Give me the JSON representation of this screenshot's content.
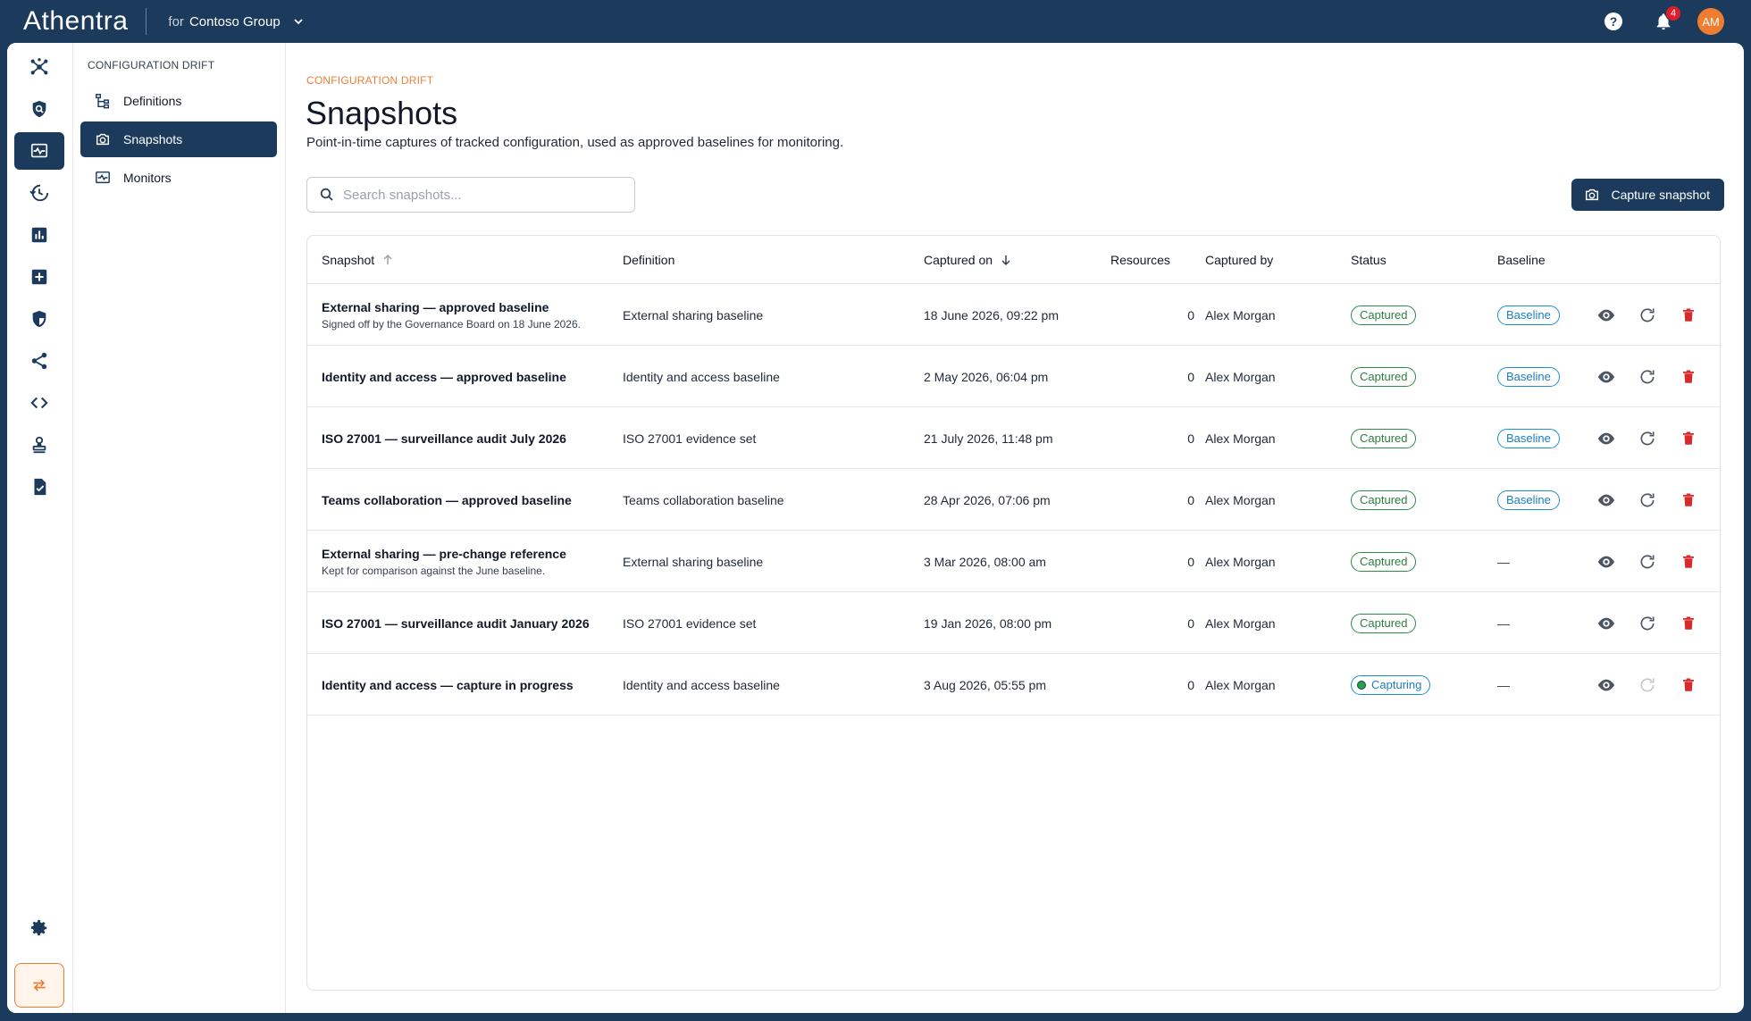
{
  "app": {
    "brand": "Athentra",
    "tenant_prefix": "for",
    "tenant_name": "Contoso Group",
    "notifications_count": "4",
    "avatar_initials": "AM",
    "accent": "#ef7d2f",
    "navy": "#1b3a5c"
  },
  "rail": {
    "items": [
      "network-icon",
      "shield-search-icon",
      "drift-monitor-icon",
      "history-icon",
      "bar-chart-icon",
      "add-box-icon",
      "security-shield-icon",
      "share-icon",
      "code-icon",
      "stamp-icon",
      "checklist-icon"
    ],
    "active": "drift-monitor-icon",
    "bottom": [
      "settings-icon",
      "swap-icon"
    ]
  },
  "subnav": {
    "heading": "CONFIGURATION DRIFT",
    "items": [
      {
        "label": "Definitions",
        "icon": "tree-icon"
      },
      {
        "label": "Snapshots",
        "icon": "camera-icon",
        "active": true
      },
      {
        "label": "Monitors",
        "icon": "monitor-icon"
      }
    ]
  },
  "page": {
    "breadcrumb": "CONFIGURATION DRIFT",
    "title": "Snapshots",
    "subtitle": "Point-in-time captures of tracked configuration, used as approved baselines for monitoring.",
    "search_placeholder": "Search snapshots...",
    "capture_button": "Capture snapshot"
  },
  "table": {
    "columns": {
      "snapshot": "Snapshot",
      "definition": "Definition",
      "captured_on": "Captured on",
      "resources": "Resources",
      "captured_by": "Captured by",
      "status": "Status",
      "baseline": "Baseline"
    },
    "rows": [
      {
        "name": "External sharing — approved baseline",
        "note": "Signed off by the Governance Board on 18 June 2026.",
        "definition": "External sharing baseline",
        "captured_on": "18 June 2026, 09:22 pm",
        "resources": "0",
        "captured_by": "Alex Morgan",
        "status": "Captured",
        "baseline": "Baseline"
      },
      {
        "name": "Identity and access — approved baseline",
        "note": "",
        "definition": "Identity and access baseline",
        "captured_on": "2 May 2026, 06:04 pm",
        "resources": "0",
        "captured_by": "Alex Morgan",
        "status": "Captured",
        "baseline": "Baseline"
      },
      {
        "name": "ISO 27001 — surveillance audit July 2026",
        "note": "",
        "definition": "ISO 27001 evidence set",
        "captured_on": "21 July 2026, 11:48 pm",
        "resources": "0",
        "captured_by": "Alex Morgan",
        "status": "Captured",
        "baseline": "Baseline"
      },
      {
        "name": "Teams collaboration — approved baseline",
        "note": "",
        "definition": "Teams collaboration baseline",
        "captured_on": "28 Apr 2026, 07:06 pm",
        "resources": "0",
        "captured_by": "Alex Morgan",
        "status": "Captured",
        "baseline": "Baseline"
      },
      {
        "name": "External sharing — pre-change reference",
        "note": "Kept for comparison against the June baseline.",
        "definition": "External sharing baseline",
        "captured_on": "3 Mar 2026, 08:00 am",
        "resources": "0",
        "captured_by": "Alex Morgan",
        "status": "Captured",
        "baseline": "—"
      },
      {
        "name": "ISO 27001 — surveillance audit January 2026",
        "note": "",
        "definition": "ISO 27001 evidence set",
        "captured_on": "19 Jan 2026, 08:00 pm",
        "resources": "0",
        "captured_by": "Alex Morgan",
        "status": "Captured",
        "baseline": "—"
      },
      {
        "name": "Identity and access — capture in progress",
        "note": "",
        "definition": "Identity and access baseline",
        "captured_on": "3 Aug 2026, 05:55 pm",
        "resources": "0",
        "captured_by": "Alex Morgan",
        "status": "Capturing",
        "baseline": "—"
      }
    ]
  }
}
